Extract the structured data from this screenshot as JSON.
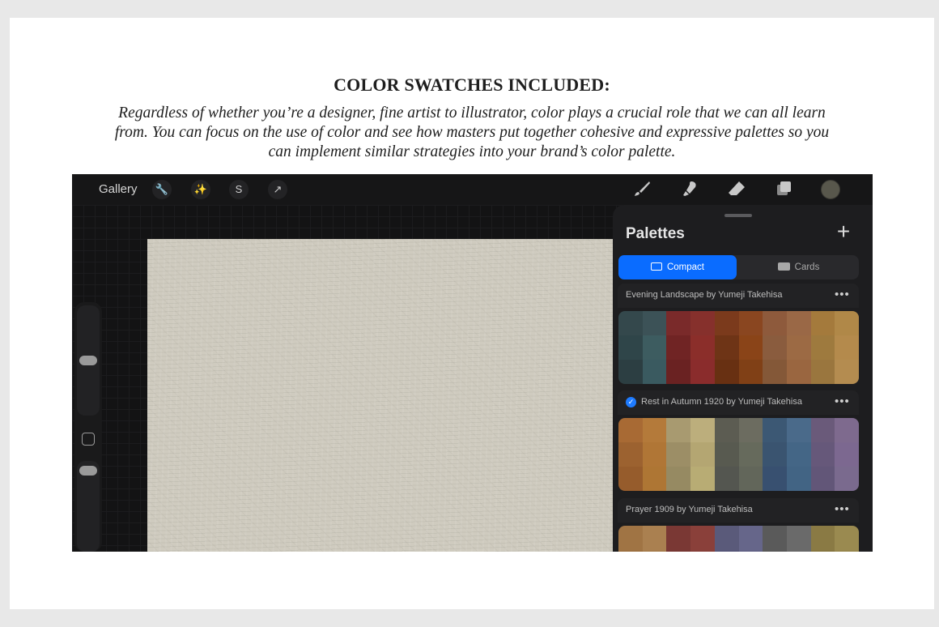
{
  "header": {
    "title": "COLOR SWATCHES INCLUDED:",
    "description": "Regardless of whether you’re a designer, fine artist to illustrator, color plays a crucial role that we can all learn from. You can focus on the use of color and see how masters put together cohesive and expressive palettes so you can implement similar strategies into your brand’s color palette."
  },
  "app": {
    "gallery_label": "Gallery",
    "left_tools": [
      "wrench-icon",
      "magic-wand-icon",
      "selection-icon",
      "transform-arrow-icon"
    ],
    "right_tools": [
      "brush-icon",
      "smudge-icon",
      "eraser-icon",
      "layers-icon"
    ],
    "current_color": "#58574c",
    "panel": {
      "title": "Palettes",
      "add_label": "+",
      "view_compact": "Compact",
      "view_cards": "Cards",
      "active_view": "Compact",
      "palettes": [
        {
          "name": "Evening Landscape by Yumeji Takehisa",
          "checked": false,
          "colors": [
            "#34484c",
            "#3c5257",
            "#7a2a2a",
            "#86302c",
            "#7b3a1c",
            "#8a4620",
            "#8e5a3c",
            "#9a6846",
            "#a47a3c",
            "#b08848",
            "#2f4549",
            "#3d5c60",
            "#702424",
            "#8b2e2a",
            "#6e3416",
            "#8a4418",
            "#8a5c3e",
            "#9c6a44",
            "#9e7a3e",
            "#b48a4c",
            "#2c3e42",
            "#3a5a60",
            "#6a2222",
            "#8a2c2c",
            "#683012",
            "#804016",
            "#845838",
            "#9a6640",
            "#9a763e",
            "#b48c50"
          ]
        },
        {
          "name": "Rest in Autumn 1920 by Yumeji Takehisa",
          "checked": true,
          "colors": [
            "#a86a34",
            "#b47a3a",
            "#a89a70",
            "#bcae7c",
            "#5c5c52",
            "#6c6c60",
            "#3c5874",
            "#4a6a8a",
            "#6a5a7a",
            "#7e6a8e",
            "#9c6230",
            "#b07636",
            "#9c8e66",
            "#b4a672",
            "#585a50",
            "#666a5c",
            "#3a5470",
            "#446686",
            "#66587a",
            "#7c6890",
            "#965c2c",
            "#ae7634",
            "#968a62",
            "#b8ac74",
            "#545650",
            "#62665a",
            "#385070",
            "#426484",
            "#625678",
            "#7a6a8e"
          ]
        },
        {
          "name": "Prayer 1909 by Yumeji Takehisa",
          "checked": false,
          "colors": [
            "#a07444",
            "#aa8050",
            "#7a3834",
            "#8a403a",
            "#5a5a7a",
            "#66668a",
            "#5a5a5a",
            "#6a6a6a",
            "#8a7a44",
            "#9a8a50",
            "#9c7040",
            "#a67c4c",
            "#763632",
            "#863e38",
            "#565678",
            "#626286",
            "#585858",
            "#686868",
            "#867640",
            "#96864c",
            "#986c3c",
            "#a27848",
            "#723430",
            "#823c36",
            "#525276",
            "#5e5e84",
            "#565656",
            "#666666",
            "#82723c",
            "#928248"
          ]
        }
      ]
    }
  }
}
